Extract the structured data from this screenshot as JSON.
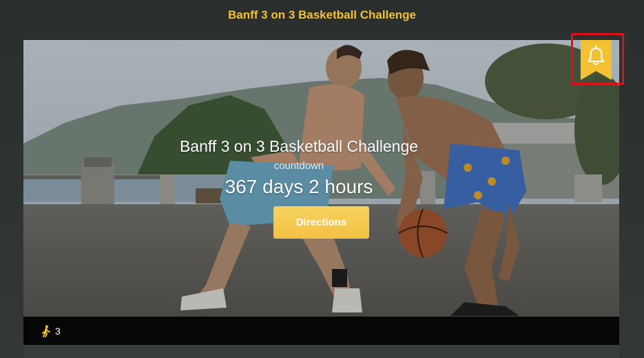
{
  "header": {
    "title": "Banff 3 on 3 Basketball Challenge"
  },
  "hero": {
    "event_title": "Banff 3 on 3 Basketball Challenge",
    "countdown_label": "countdown",
    "countdown_value": "367 days 2 hours",
    "directions_label": "Directions"
  },
  "notification": {
    "icon": "bell-icon"
  },
  "footer": {
    "icon": "person-walking-icon",
    "attendee_count": "3"
  },
  "colors": {
    "accent": "#f2c233",
    "highlight": "#e0101b",
    "footer_bg": "#060606"
  }
}
